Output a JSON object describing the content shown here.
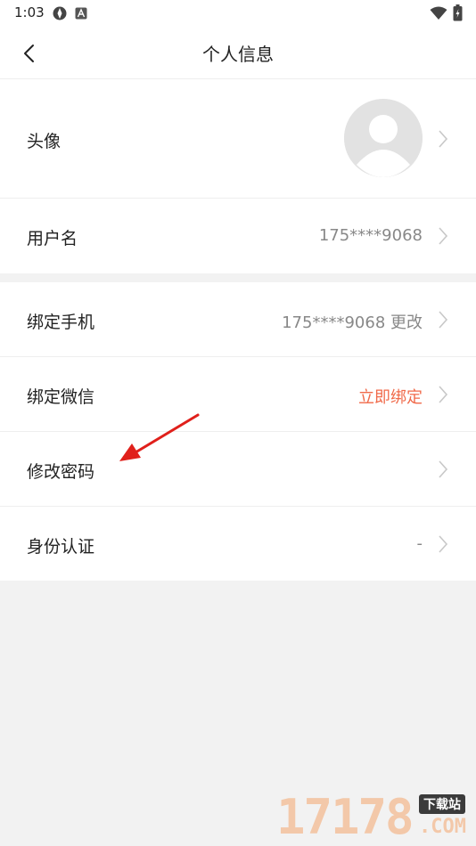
{
  "status_bar": {
    "time": "1:03"
  },
  "nav": {
    "title": "个人信息"
  },
  "profile_group": {
    "avatar_label": "头像",
    "username_label": "用户名",
    "username_value": "175****9068"
  },
  "account_group": {
    "phone_label": "绑定手机",
    "phone_value": "175****9068 更改",
    "wechat_label": "绑定微信",
    "wechat_value": "立即绑定",
    "password_label": "修改密码",
    "identity_label": "身份认证",
    "identity_value": "-"
  },
  "watermark": {
    "digits": "17178",
    "badge": "下载站",
    "domain": ".COM"
  },
  "colors": {
    "accent": "#f06a4a",
    "annotation_arrow": "#e0201b"
  }
}
